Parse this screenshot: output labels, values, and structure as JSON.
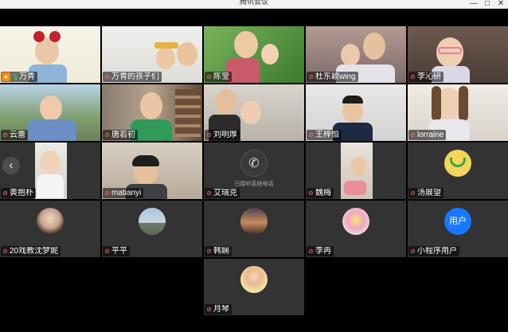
{
  "window": {
    "title": "腾讯会议",
    "minimize_icon": "minimize-icon",
    "maximize_icon": "maximize-icon",
    "close_icon": "close-icon"
  },
  "participants": [
    {
      "name": "万青",
      "mic": "on",
      "host": true,
      "active": true
    },
    {
      "name": "万青的孩子们",
      "mic": "muted",
      "extra": "screen-icon"
    },
    {
      "name": "陈莹",
      "mic": "muted"
    },
    {
      "name": "杜东颖wing",
      "mic": "muted"
    },
    {
      "name": "李沁研",
      "mic": "muted"
    },
    {
      "name": "云蕾",
      "mic": "muted"
    },
    {
      "name": "唐若初",
      "mic": "muted"
    },
    {
      "name": "刘明厚",
      "mic": "muted"
    },
    {
      "name": "王梓恒",
      "mic": "muted"
    },
    {
      "name": "lorraine",
      "mic": "muted"
    },
    {
      "name": "黄抱朴",
      "mic": "muted"
    },
    {
      "name": "matianyi",
      "mic": "muted"
    },
    {
      "name": "艾瑞克",
      "mic": "muted",
      "sub": "已接听系统电话"
    },
    {
      "name": "魏梅",
      "mic": "muted"
    },
    {
      "name": "汤展望",
      "mic": "muted"
    },
    {
      "name": "20戏教沈梦妮",
      "mic": "muted"
    },
    {
      "name": "平平",
      "mic": "muted"
    },
    {
      "name": "韩娴",
      "mic": "muted"
    },
    {
      "name": "李冉",
      "mic": "muted"
    },
    {
      "name": "小程序用户",
      "mic": "muted",
      "avatar_text": "用户"
    },
    {
      "name": "月琴",
      "mic": "muted"
    }
  ],
  "colors": {
    "background": "#000000",
    "tile": "#333333",
    "active_border": "#6bd06b",
    "muted_mic": "#ff6b6b",
    "user_avatar": "#1677ff",
    "host_badge": "#ff8a00"
  }
}
